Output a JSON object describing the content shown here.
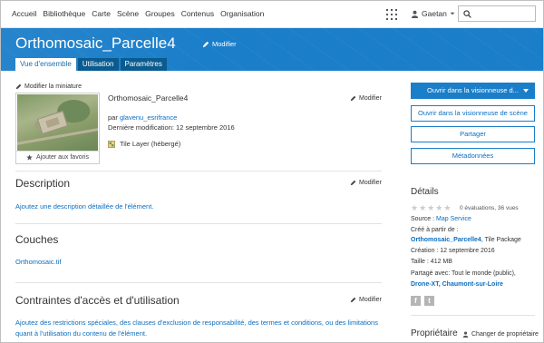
{
  "nav": {
    "links": [
      "Accueil",
      "Bibliothèque",
      "Carte",
      "Scène",
      "Groupes",
      "Contenus",
      "Organisation"
    ],
    "user": "Gaetan"
  },
  "header": {
    "title": "Orthomosaic_Parcelle4",
    "edit_label": "Modifier",
    "tabs": [
      "Vue d'ensemble",
      "Utilisation",
      "Paramètres"
    ]
  },
  "thumbnail": {
    "edit_label": "Modifier la miniature",
    "favorite_label": "Ajouter aux favoris"
  },
  "summary": {
    "title": "Orthomosaic_Parcelle4",
    "edit_label": "Modifier",
    "by_prefix": "par",
    "owner": "glavenu_esrifrance",
    "last_modified": "Dernière modification: 12 septembre 2016",
    "type": "Tile Layer (hébergé)"
  },
  "description": {
    "title": "Description",
    "edit_label": "Modifier",
    "placeholder": "Ajoutez une description détaillée de l'élément."
  },
  "layers": {
    "title": "Couches",
    "items": [
      "Orthomosaic.tif"
    ]
  },
  "constraints": {
    "title": "Contraintes d'accès et d'utilisation",
    "edit_label": "Modifier",
    "text": "Ajoutez des restrictions spéciales, des clauses d'exclusion de responsabilité, des termes et conditions, ou des limitations quant à l'utilisation du contenu de l'élément."
  },
  "actions": {
    "open_viewer": "Ouvrir dans la visionneuse d...",
    "open_scene": "Ouvrir dans la visionneuse de scène",
    "share": "Partager",
    "metadata": "Métadonnées"
  },
  "details": {
    "title": "Détails",
    "rating": 0,
    "ratings_text": "0 évaluations, 36 vues",
    "source_label": "Source :",
    "source_value": "Map Service",
    "created_from": "Créé à partir de :",
    "created_from_link": "Orthomosaic_Parcelle4",
    "created_from_type": ", Tile Package",
    "creation": "Création : 12 septembre 2016",
    "size_label": "Taille :",
    "size_value": "412 MB",
    "shared_label": "Partagé avec:",
    "shared_value": "Tout le monde (public),",
    "shared_groups": "Drone-XT, Chaumont-sur-Loire"
  },
  "owner": {
    "title": "Propriétaire",
    "change_label": "Changer de propriétaire"
  },
  "colors": {
    "brand_blue": "#1b7ec9",
    "tab_dark": "#0a5b8f",
    "link": "#0a6ec0"
  }
}
